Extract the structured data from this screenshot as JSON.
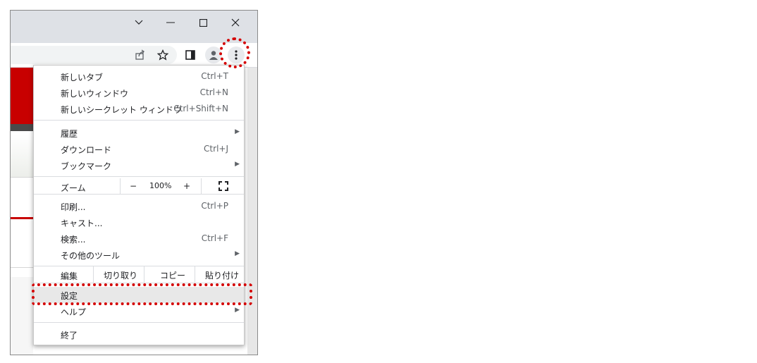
{
  "window": {
    "chevron_icon": "chevron-down-icon",
    "minimize_icon": "minimize-icon",
    "maximize_icon": "maximize-icon",
    "close_icon": "close-icon"
  },
  "toolbar": {
    "share_icon": "share-icon",
    "bookmark_icon": "star-icon",
    "sidepanel_icon": "side-panel-icon",
    "profile_icon": "profile-icon",
    "menu_icon": "kebab-menu-icon"
  },
  "menu": {
    "new_tab": {
      "label": "新しいタブ",
      "shortcut": "Ctrl+T"
    },
    "new_window": {
      "label": "新しいウィンドウ",
      "shortcut": "Ctrl+N"
    },
    "incognito": {
      "label": "新しいシークレット ウィンドウ",
      "shortcut": "Ctrl+Shift+N"
    },
    "history": {
      "label": "履歴"
    },
    "downloads": {
      "label": "ダウンロード",
      "shortcut": "Ctrl+J"
    },
    "bookmarks": {
      "label": "ブックマーク"
    },
    "zoom": {
      "label": "ズーム",
      "minus": "−",
      "value": "100%",
      "plus": "+"
    },
    "print": {
      "label": "印刷...",
      "shortcut": "Ctrl+P"
    },
    "cast": {
      "label": "キャスト..."
    },
    "find": {
      "label": "検索...",
      "shortcut": "Ctrl+F"
    },
    "more_tools": {
      "label": "その他のツール"
    },
    "edit": {
      "label": "編集",
      "cut": "切り取り",
      "copy": "コピー",
      "paste": "貼り付け"
    },
    "settings": {
      "label": "設定"
    },
    "help": {
      "label": "ヘルプ"
    },
    "exit": {
      "label": "終了"
    }
  },
  "colors": {
    "highlight_red": "#d40000",
    "page_red": "#c80000",
    "titlebar": "#dee1e6"
  }
}
